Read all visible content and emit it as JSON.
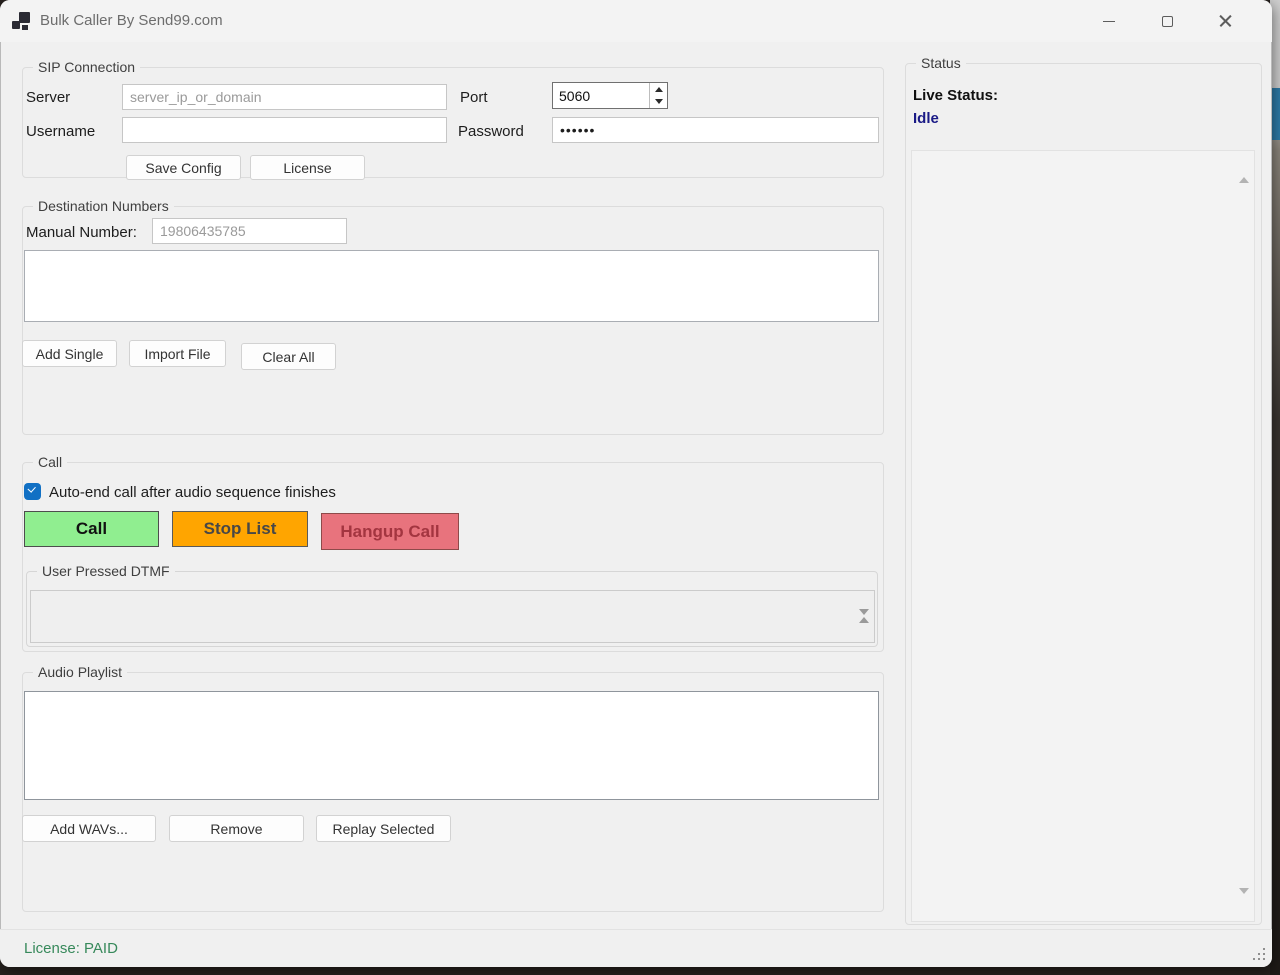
{
  "titlebar": {
    "title": "Bulk Caller By Send99.com"
  },
  "sip": {
    "group_label": "SIP Connection",
    "server_label": "Server",
    "server_placeholder": "server_ip_or_domain",
    "port_label": "Port",
    "port_value": "5060",
    "username_label": "Username",
    "username_value": "",
    "password_label": "Password",
    "password_value": "••••••",
    "save_config_label": "Save Config",
    "license_label": "License"
  },
  "destination": {
    "group_label": "Destination Numbers",
    "manual_number_label": "Manual Number:",
    "manual_number_value": "19806435785",
    "add_single_label": "Add Single",
    "import_file_label": "Import File",
    "clear_all_label": "Clear All"
  },
  "call": {
    "group_label": "Call",
    "auto_end_label": "Auto-end call after audio sequence finishes",
    "auto_end_checked": true,
    "call_button_label": "Call",
    "stop_list_button_label": "Stop List",
    "hangup_button_label": "Hangup Call",
    "dtmf_group_label": "User Pressed DTMF",
    "dtmf_value": ""
  },
  "playlist": {
    "group_label": "Audio Playlist",
    "add_wavs_label": "Add WAVs...",
    "remove_label": "Remove",
    "replay_selected_label": "Replay Selected"
  },
  "status": {
    "group_label": "Status",
    "live_status_label": "Live Status:",
    "live_status_value": "Idle"
  },
  "statusbar": {
    "license_text": "License: PAID"
  },
  "colors": {
    "call_button": "#90ee90",
    "stop_button": "#ffa500",
    "hangup_button": "#e8737d",
    "idle_text": "#1a1a86",
    "license_text": "#37895b",
    "checkbox": "#1170c4"
  }
}
